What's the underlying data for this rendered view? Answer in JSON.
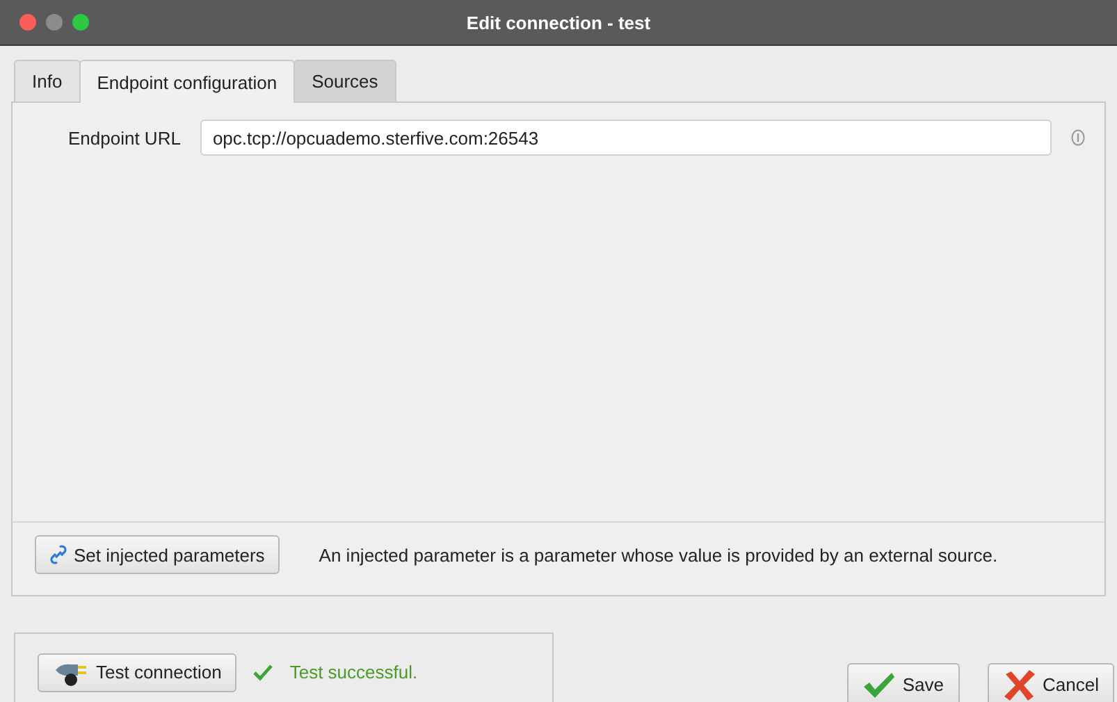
{
  "window": {
    "title": "Edit connection - test"
  },
  "tabs": [
    {
      "label": "Info",
      "selected": false
    },
    {
      "label": "Endpoint configuration",
      "selected": true
    },
    {
      "label": "Sources",
      "selected": false
    }
  ],
  "endpoint": {
    "label": "Endpoint URL",
    "value": "opc.tcp://opcuademo.sterfive.com:26543"
  },
  "injected": {
    "button": "Set injected parameters",
    "description": "An injected parameter is a parameter whose value is provided by an external source."
  },
  "test": {
    "button": "Test connection",
    "success": true,
    "message": "Test successful."
  },
  "buttons": [
    {
      "kind": "save",
      "label": "Save"
    },
    {
      "kind": "cancel",
      "label": "Cancel"
    }
  ]
}
